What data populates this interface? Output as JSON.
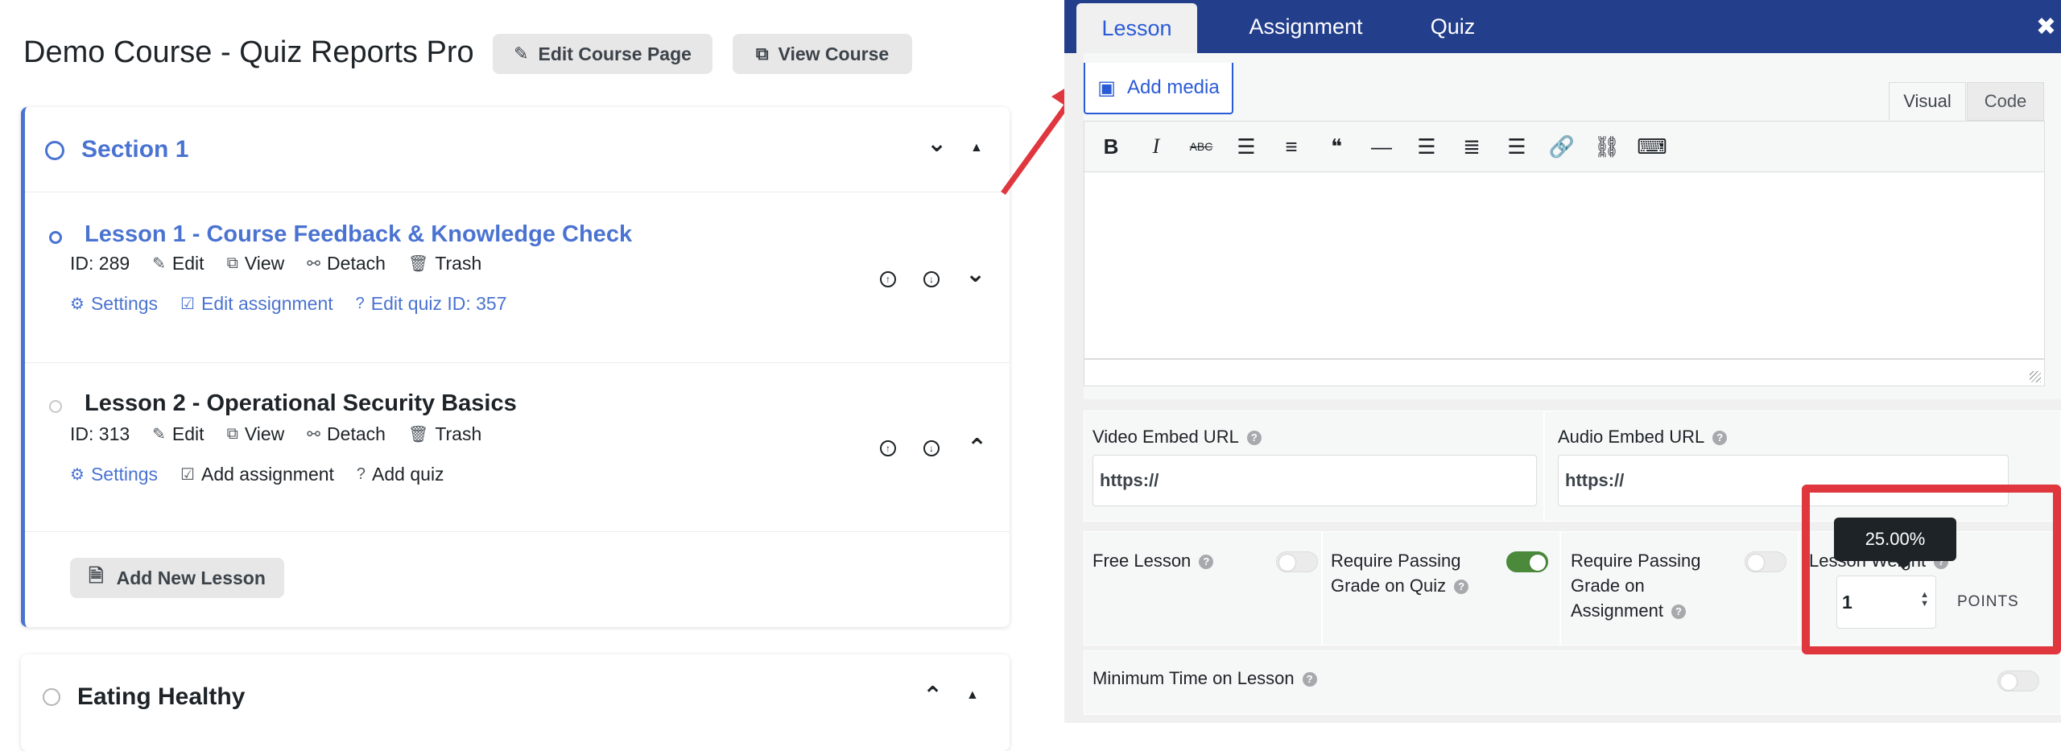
{
  "header": {
    "course_title": "Demo Course - Quiz Reports Pro",
    "edit_course_page": "Edit Course Page",
    "view_course": "View Course"
  },
  "sections": [
    {
      "title": "Section 1",
      "lessons": [
        {
          "title": "Lesson 1 - Course Feedback & Knowledge Check",
          "id_text": "ID: 289",
          "actions": [
            "Edit",
            "View",
            "Detach",
            "Trash"
          ],
          "settings": "Settings",
          "assignment": "Edit assignment",
          "quiz": "Edit quiz ID: 357"
        },
        {
          "title": "Lesson 2 - Operational Security Basics",
          "id_text": "ID: 313",
          "actions": [
            "Edit",
            "View",
            "Detach",
            "Trash"
          ],
          "settings": "Settings",
          "assignment": "Add assignment",
          "quiz": "Add quiz"
        }
      ],
      "add_lesson": "Add New Lesson"
    },
    {
      "title": "Eating Healthy"
    }
  ],
  "panel": {
    "tabs": [
      "Lesson",
      "Assignment",
      "Quiz"
    ],
    "active_tab": "Lesson",
    "close_icon": "close-icon",
    "add_media": "Add media",
    "editor_tabs": [
      "Visual",
      "Code"
    ],
    "toolbar_icons": [
      "bold-icon",
      "italic-icon",
      "strikethrough-icon",
      "bullet-list-icon",
      "numbered-list-icon",
      "blockquote-icon",
      "horizontal-rule-icon",
      "align-left-icon",
      "align-center-icon",
      "align-right-icon",
      "link-icon",
      "unlink-icon",
      "keyboard-icon"
    ],
    "video_embed_label": "Video Embed URL",
    "video_embed_value": "https://",
    "audio_embed_label": "Audio Embed URL",
    "audio_embed_value": "https://",
    "free_lesson_label": "Free Lesson",
    "free_lesson_on": false,
    "require_quiz_label": "Require Passing Grade on Quiz",
    "require_quiz_on": true,
    "require_assignment_label": "Require Passing Grade on Assignment",
    "require_assignment_on": false,
    "lesson_weight_label": "Lesson Weight",
    "lesson_weight_value": "1",
    "points_label": "POINTS",
    "tooltip": "25.00%",
    "min_time_label": "Minimum Time on Lesson",
    "min_time_on": false
  },
  "colors": {
    "accent_blue": "#4a73d1",
    "panel_header": "#233e8b",
    "toggle_on": "#4a8a3a",
    "annotation_red": "#e0363e"
  }
}
